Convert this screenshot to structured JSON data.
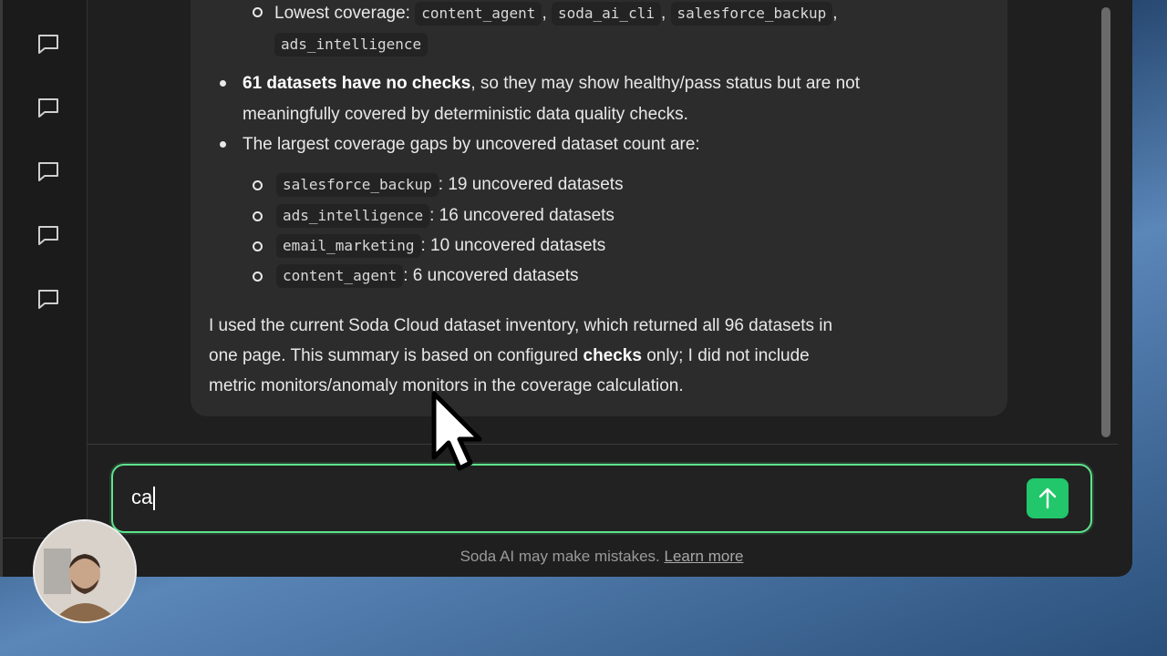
{
  "sidebar": {
    "items": [
      {
        "icon": "chat-icon"
      },
      {
        "icon": "chat-icon"
      },
      {
        "icon": "chat-icon"
      },
      {
        "icon": "chat-icon"
      },
      {
        "icon": "chat-icon"
      }
    ]
  },
  "message": {
    "lowest_coverage_label": "Lowest coverage:",
    "lowest_coverage_items": [
      "content_agent",
      "soda_ai_cli",
      "salesforce_backup",
      "ads_intelligence"
    ],
    "bullet1_bold": "61 datasets have no checks",
    "bullet1_rest": ", so they may show healthy/pass status but are not",
    "bullet1_line2": "meaningfully covered by deterministic data quality checks.",
    "bullet2": "The largest coverage gaps by uncovered dataset count are:",
    "gaps": [
      {
        "name": "salesforce_backup",
        "text": ": 19 uncovered datasets"
      },
      {
        "name": "ads_intelligence",
        "text": ": 16 uncovered datasets"
      },
      {
        "name": "email_marketing",
        "text": ": 10 uncovered datasets"
      },
      {
        "name": "content_agent",
        "text": ": 6 uncovered datasets"
      }
    ],
    "para_line1": "I used the current Soda Cloud dataset inventory, which returned all 96 datasets in",
    "para_line2_a": "one page. This summary is based on configured ",
    "para_line2_bold": "checks",
    "para_line2_b": " only; I did not include",
    "para_line3": "metric monitors/anomaly monitors in the coverage calculation."
  },
  "composer": {
    "value": "ca",
    "send_icon": "arrow-up-icon"
  },
  "footer": {
    "disclaimer": "Soda AI may make mistakes.",
    "learn_more": "Learn more"
  },
  "colors": {
    "accent": "#21c76a",
    "input_border": "#5ee38d"
  }
}
